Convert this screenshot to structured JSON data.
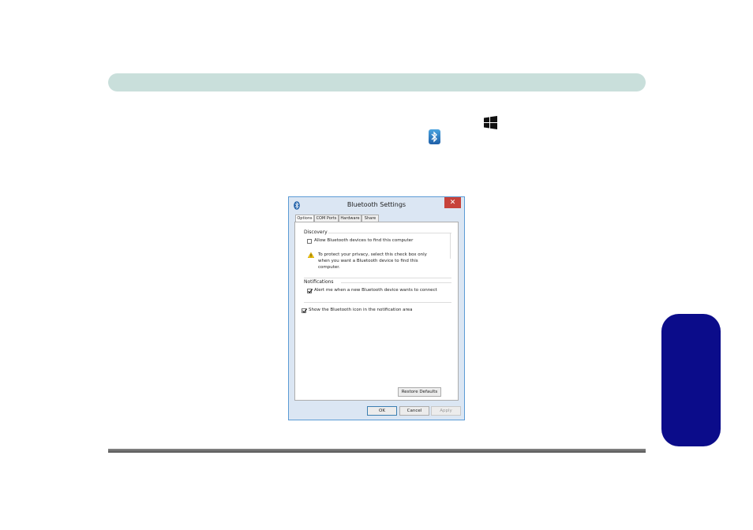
{
  "dialog": {
    "title": "Bluetooth Settings",
    "close_label": "✕",
    "tabs": [
      {
        "label": "Options",
        "active": true
      },
      {
        "label": "COM Ports",
        "active": false
      },
      {
        "label": "Hardware",
        "active": false
      },
      {
        "label": "Share",
        "active": false
      }
    ],
    "discovery": {
      "label": "Discovery",
      "allow_label": "Allow Bluetooth devices to find this computer",
      "allow_checked": false,
      "info_text": "To protect your privacy, select this check box only when you want a Bluetooth device to find this computer."
    },
    "notifications": {
      "label": "Notifications",
      "alert_label": "Alert me when a new Bluetooth device wants to connect",
      "alert_checked": true
    },
    "show_icon_label": "Show the Bluetooth icon in the notification area",
    "show_icon_checked": true,
    "restore_label": "Restore Defaults",
    "ok_label": "OK",
    "cancel_label": "Cancel",
    "apply_label": "Apply"
  },
  "icons": [
    "windows-logo-icon",
    "bluetooth-icon",
    "warning-icon",
    "checkmark-icon"
  ],
  "colors": {
    "header_bar": "#c9dfdb",
    "side_tab": "#0b0c8a",
    "close_button": "#c7423a",
    "dialog_border": "#5c9bd5",
    "bluetooth_blue": "#1e5fa8"
  }
}
